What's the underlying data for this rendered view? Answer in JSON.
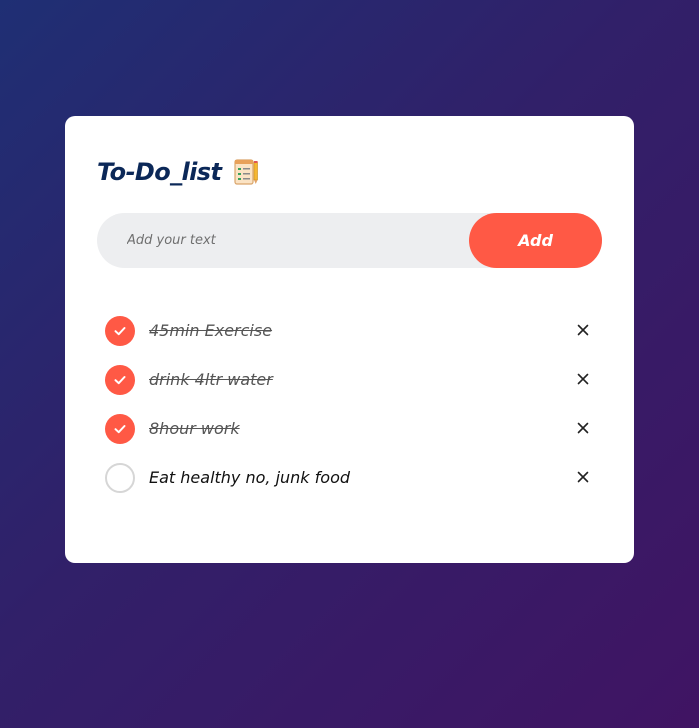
{
  "app": {
    "title": "To-Do_list",
    "title_icon": "notepad-checklist-icon"
  },
  "input": {
    "placeholder": "Add your text",
    "value": "",
    "add_label": "Add"
  },
  "colors": {
    "accent": "#ff5945",
    "title": "#0b2858",
    "input_bg": "#edeef0"
  },
  "tasks": [
    {
      "text": "45min Exercise",
      "done": true
    },
    {
      "text": "drink 4ltr water",
      "done": true
    },
    {
      "text": "8hour work",
      "done": true
    },
    {
      "text": "Eat healthy no, junk food",
      "done": false
    }
  ],
  "icons": {
    "checked": "check-icon",
    "delete": "close-icon"
  }
}
